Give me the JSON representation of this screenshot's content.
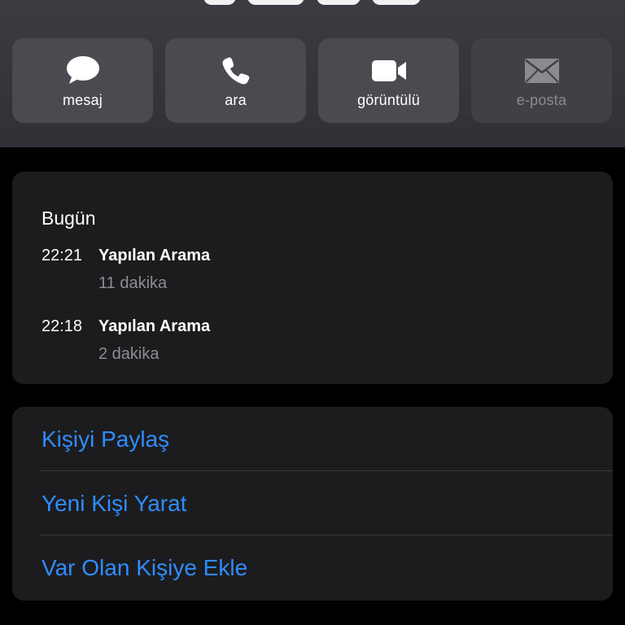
{
  "actions": {
    "message": {
      "label": "mesaj",
      "icon": "message-bubble-icon"
    },
    "call": {
      "label": "ara",
      "icon": "phone-icon"
    },
    "video": {
      "label": "görüntülü",
      "icon": "video-camera-icon"
    },
    "email": {
      "label": "e-posta",
      "icon": "envelope-icon",
      "disabled": true
    }
  },
  "history": {
    "title": "Bugün",
    "entries": [
      {
        "time": "22:21",
        "type": "Yapılan Arama",
        "duration": "11 dakika"
      },
      {
        "time": "22:18",
        "type": "Yapılan Arama",
        "duration": "2 dakika"
      }
    ]
  },
  "contact_actions": {
    "share": "Kişiyi Paylaş",
    "create": "Yeni Kişi Yarat",
    "add_existing": "Var Olan Kişiye Ekle"
  },
  "colors": {
    "accent": "#2f8cff",
    "card": "#1c1c1e",
    "action_button": "#494b51",
    "secondary_text": "#8d8d92"
  }
}
